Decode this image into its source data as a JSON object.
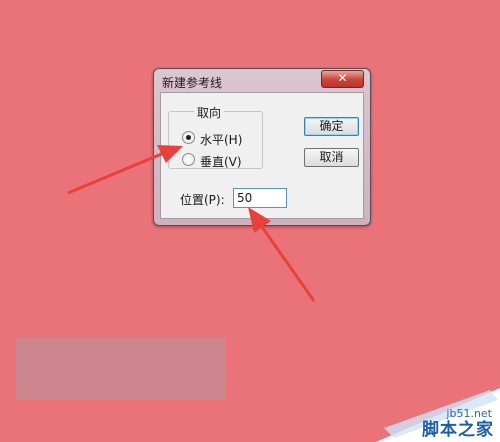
{
  "dialog": {
    "title": "新建参考线",
    "close_label": "✕",
    "orientation_group": {
      "legend": "取向",
      "options": [
        {
          "label": "水平(H)",
          "selected": true
        },
        {
          "label": "垂直(V)",
          "selected": false
        }
      ]
    },
    "ok_label": "确定",
    "cancel_label": "取消",
    "position_label": "位置(P):",
    "position_value": "50"
  },
  "watermark": {
    "url": "jb51.net",
    "brand": "脚本之家"
  },
  "colors": {
    "background": "#ea7379",
    "arrow": "#e8413c",
    "watermark_blue": "#1c5ea8"
  }
}
